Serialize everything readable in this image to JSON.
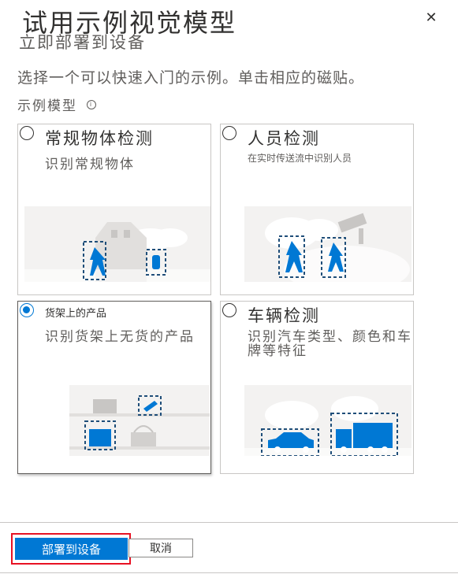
{
  "header": {
    "title": "试用示例视觉模型",
    "subtitle": "立即部署到设备",
    "close_icon": "close-icon"
  },
  "description": "选择一个可以快速入门的示例。单击相应的磁贴。",
  "samples_label": "示例模型",
  "tiles": [
    {
      "title": "常规物体检测",
      "desc": "识别常规物体",
      "selected": false,
      "icon": "common-objects-illustration"
    },
    {
      "title": "人员检测",
      "desc": "在实时传送流中识别人员",
      "selected": false,
      "icon": "people-illustration"
    },
    {
      "title": "货架上的产品",
      "desc": "识别货架上无货的产品",
      "selected": true,
      "icon": "shelf-products-illustration"
    },
    {
      "title": "车辆检测",
      "desc": "识别汽车类型、颜色和车牌等特征",
      "selected": false,
      "icon": "vehicle-illustration"
    }
  ],
  "footer": {
    "deploy_label": "部署到设备",
    "cancel_label": "取消"
  },
  "colors": {
    "accent": "#0078d4",
    "highlight": "#e81123"
  }
}
